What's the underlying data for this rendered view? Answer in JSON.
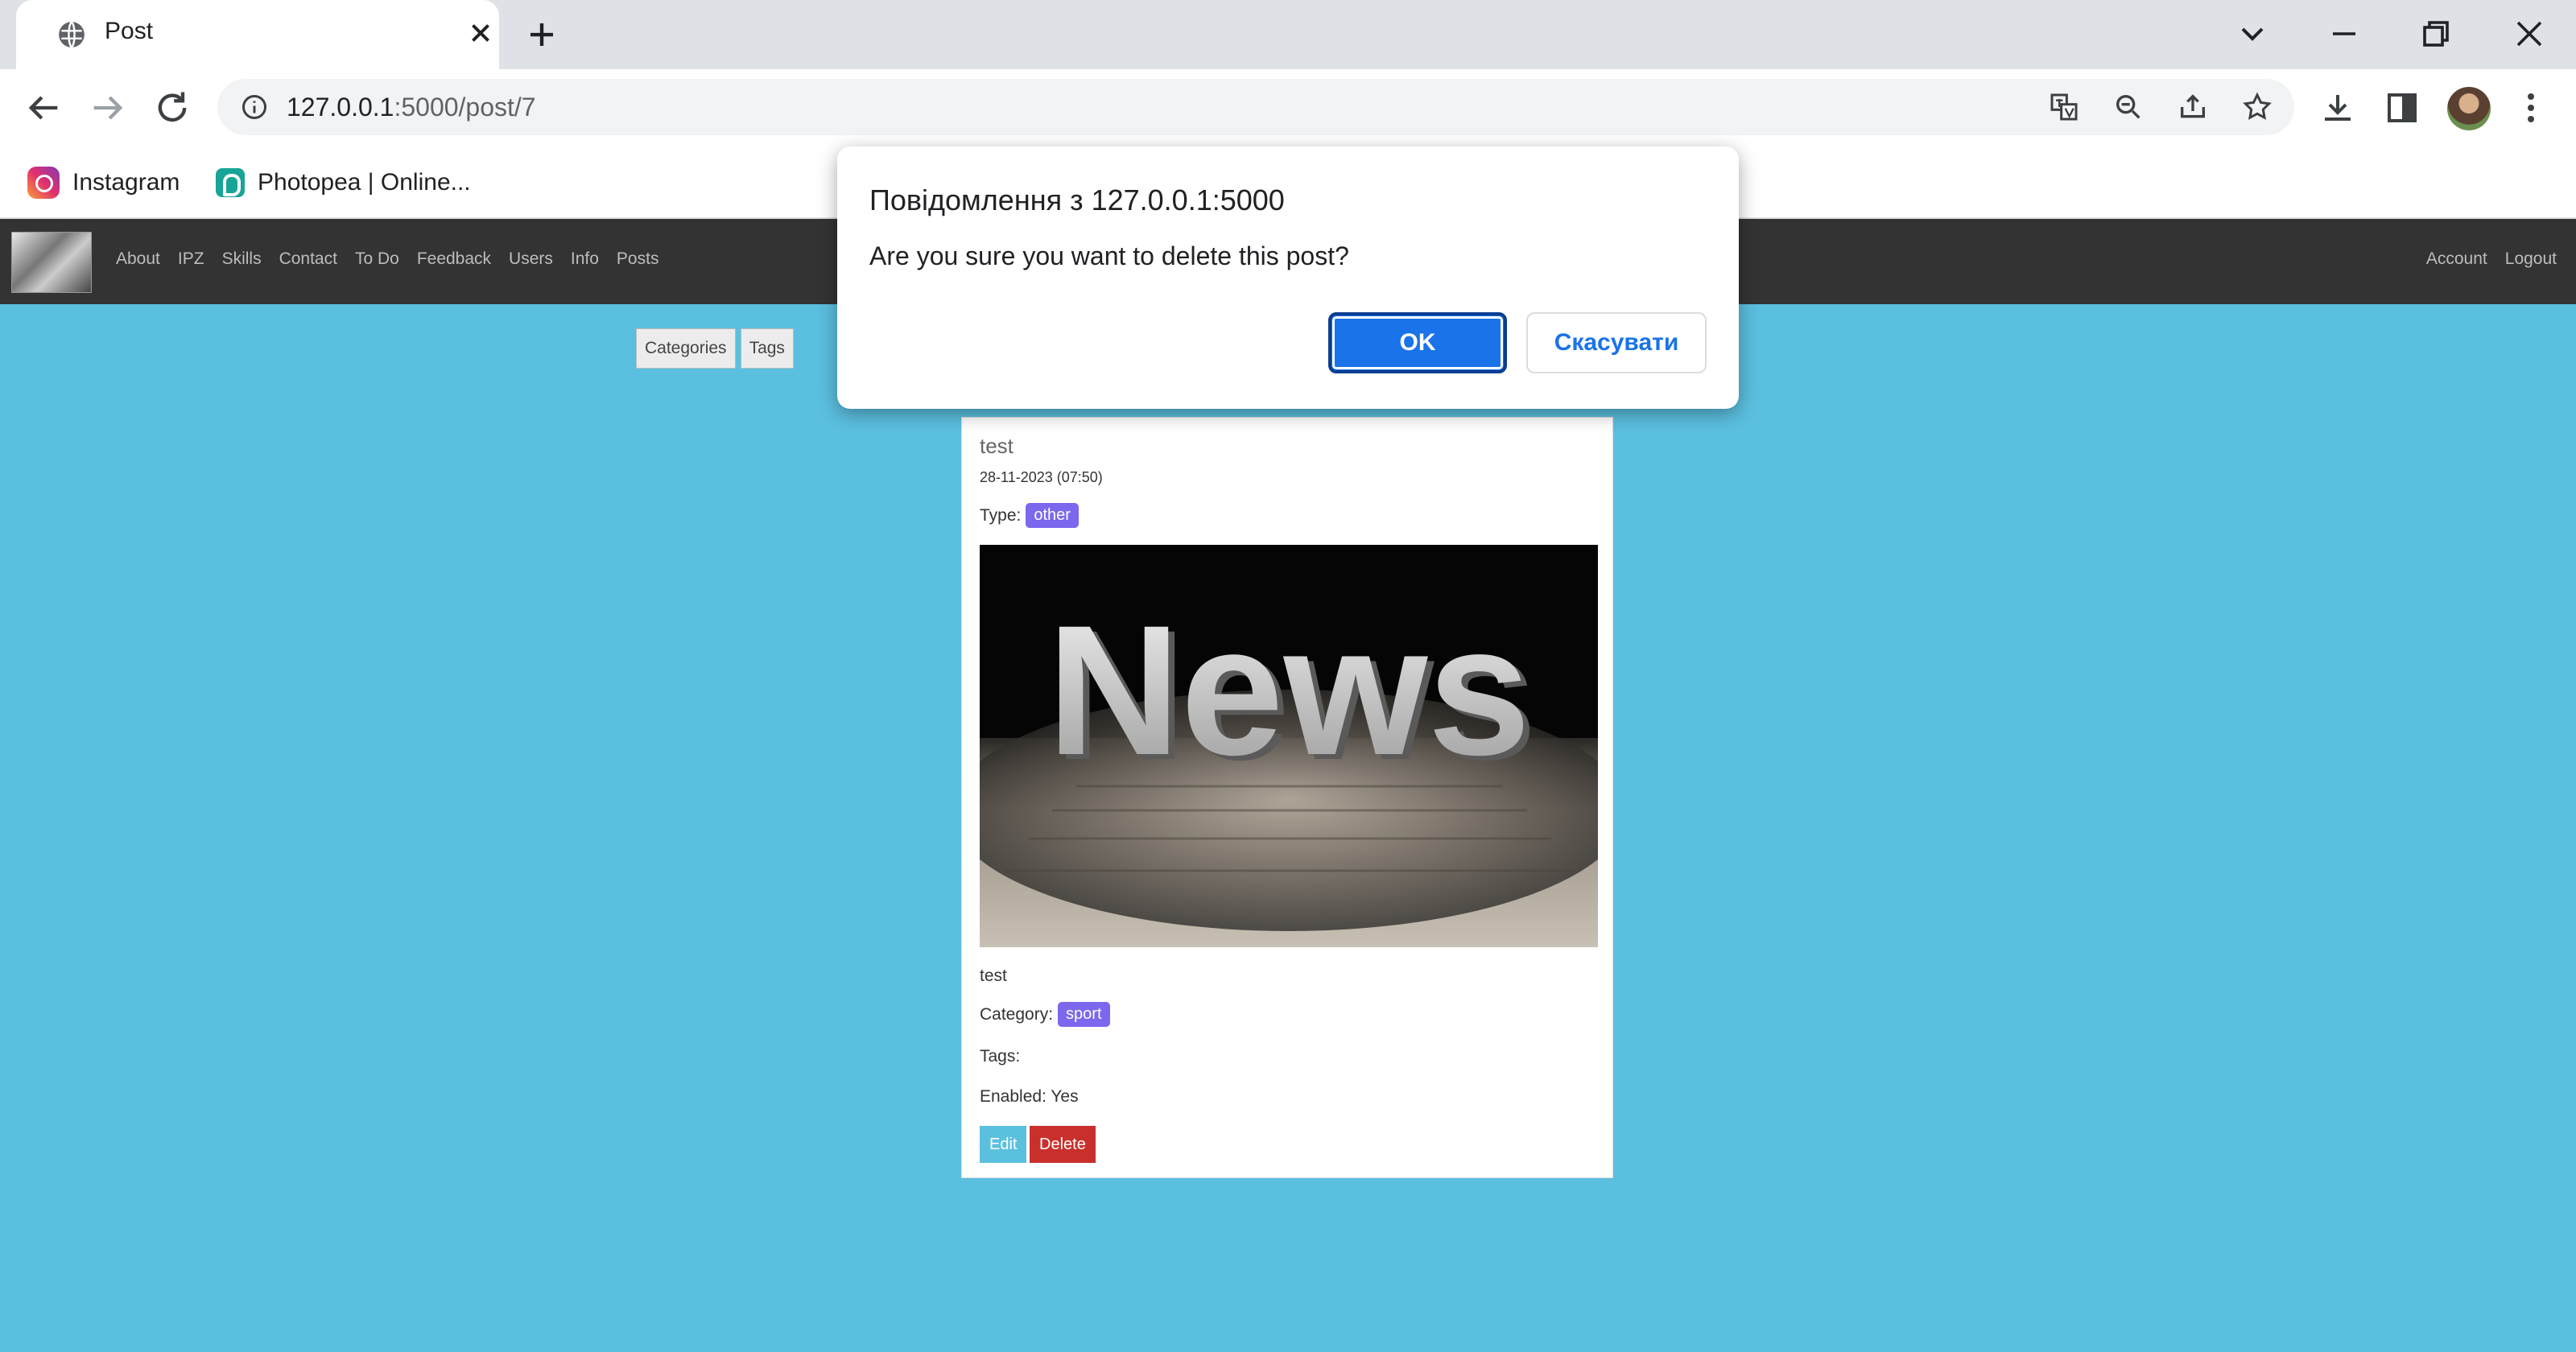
{
  "browser": {
    "tab_title": "Post",
    "url_host": "127.0.0.1",
    "url_rest": ":5000/post/7",
    "bookmarks": [
      {
        "label": "Instagram",
        "icon": "instagram-icon"
      },
      {
        "label": "Photopea | Online...",
        "icon": "photopea-icon"
      }
    ]
  },
  "navbar": {
    "links": [
      "About",
      "IPZ",
      "Skills",
      "Contact",
      "To Do",
      "Feedback",
      "Users",
      "Info",
      "Posts"
    ],
    "right_links": [
      "Account",
      "Logout"
    ]
  },
  "sub_nav": {
    "categories_label": "Categories",
    "tags_label": "Tags"
  },
  "post": {
    "title": "test",
    "date": "28-11-2023 (07:50)",
    "type_label": "Type:",
    "type_value": "other",
    "image_text": "News",
    "body": "test",
    "category_label": "Category:",
    "category_value": "sport",
    "tags_label": "Tags:",
    "enabled_text": "Enabled: Yes",
    "edit_label": "Edit",
    "delete_label": "Delete"
  },
  "dialog": {
    "title": "Повідомлення з 127.0.0.1:5000",
    "message": "Are you sure you want to delete this post?",
    "ok_label": "OK",
    "cancel_label": "Скасувати"
  },
  "colors": {
    "page_bg": "#5bbfdf",
    "navbar_bg": "#333333",
    "badge": "#7b68ee",
    "edit": "#5bc0de",
    "delete": "#c9302c",
    "dialog_ok": "#1a73e8"
  }
}
